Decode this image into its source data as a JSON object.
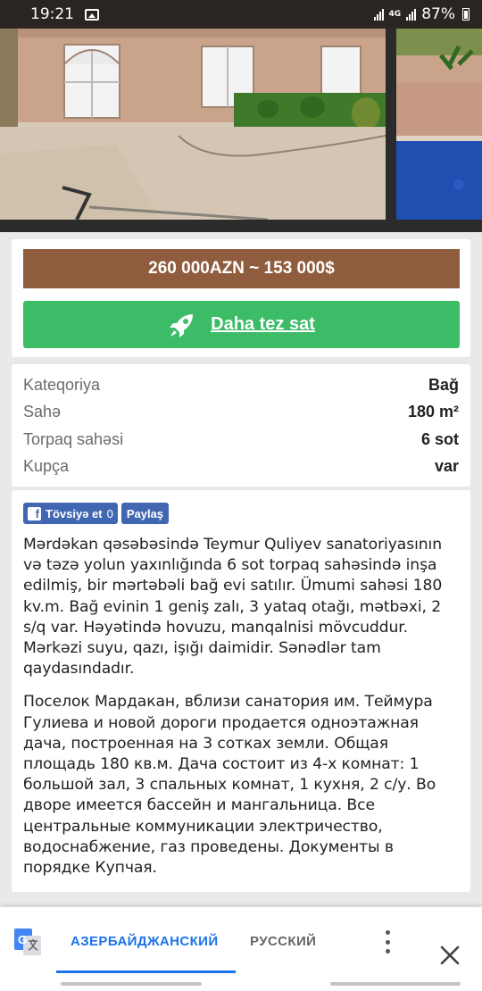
{
  "status_bar": {
    "time": "19:21",
    "network_type": "4G",
    "battery": "87%"
  },
  "photo": {
    "subject": "house-exterior-with-pool"
  },
  "price": {
    "text": "260 000AZN ~ 153 000$"
  },
  "sell_faster": {
    "label": "Daha tez sat",
    "icon": "rocket-icon"
  },
  "details": [
    {
      "key": "Kateqoriya",
      "value": "Bağ"
    },
    {
      "key": "Sahə",
      "value": "180 m²"
    },
    {
      "key": "Torpaq sahəsi",
      "value": "6 sot"
    },
    {
      "key": "Kupça",
      "value": "var"
    }
  ],
  "social": {
    "like_label": "Tövsiyə et",
    "like_count": "0",
    "share_label": "Paylaş"
  },
  "description": {
    "az": "Mərdəkan qəsəbəsində Teymur Quliyev sanatoriyasının və təzə yolun yaxınlığında 6 sot torpaq sahəsində inşa edilmiş, bir mərtəbəli bağ evi satılır. Ümumi sahəsi 180 kv.m. Bağ evinin 1 geniş zalı, 3 yataq otağı, mətbəxi, 2 s/q var. Həyətində hovuzu, manqalnisi mövcuddur. Mərkəzi suyu, qazı, işığı daimidir. Sənədlər tam qaydasındadır.",
    "ru": "Поселок Мардакан, вблизи санатория им. Теймура Гулиева и новой дороги продается одноэтажная дача, построенная на 3 сотках земли. Общая площадь 180 кв.м. Дача состоит из 4-х комнат: 1 большой зал, 3 спальных комнат, 1 кухня, 2 с/у. Во дворе имеется бассейн и мангальница. Все центральные коммуникации электричество, водоснабжение, газ проведены. Документы в порядке Купчая."
  },
  "translate_bar": {
    "active_language": "АЗЕРБАЙДЖАНСКИЙ",
    "other_language": "РУССКИЙ"
  },
  "colors": {
    "price_bar": "#8f5d3e",
    "sell_button": "#3cbc67",
    "facebook": "#4267b2",
    "translate_accent": "#1a73e8"
  }
}
